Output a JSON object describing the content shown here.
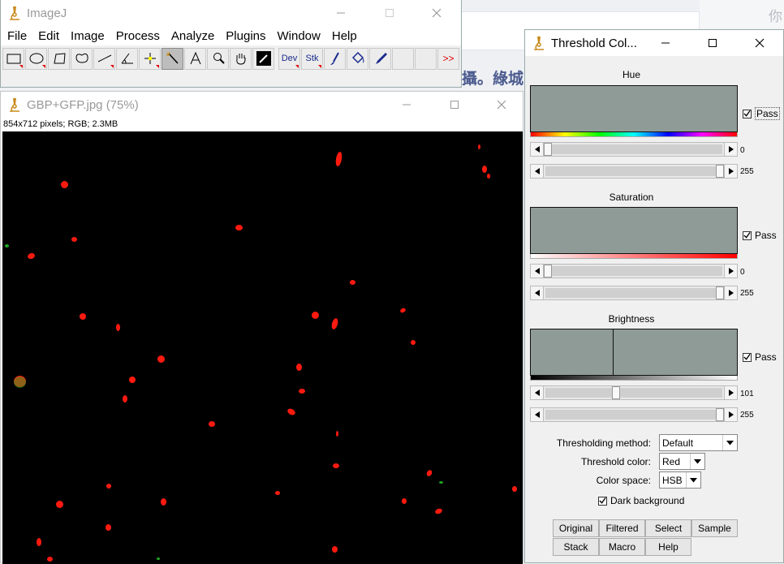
{
  "background": {
    "corner_glyph": "你",
    "heading_fragment": "攝。綠城"
  },
  "imagej": {
    "title": "ImageJ",
    "menu": [
      "File",
      "Edit",
      "Image",
      "Process",
      "Analyze",
      "Plugins",
      "Window",
      "Help"
    ],
    "tools": {
      "dev_label": "Dev",
      "stk_label": "Stk",
      "more_label": ">>"
    }
  },
  "image_window": {
    "title": "GBP+GFP.jpg (75%)",
    "info": "854x712 pixels; RGB; 2.3MB"
  },
  "threshold": {
    "title": "Threshold Col...",
    "hue": {
      "label": "Hue",
      "pass_label": "Pass",
      "pass_checked": true,
      "min": "0",
      "max": "255",
      "min_frac": 0.0,
      "max_frac": 1.0
    },
    "saturation": {
      "label": "Saturation",
      "pass_label": "Pass",
      "pass_checked": true,
      "min": "0",
      "max": "255",
      "min_frac": 0.0,
      "max_frac": 1.0
    },
    "brightness": {
      "label": "Brightness",
      "pass_label": "Pass",
      "pass_checked": true,
      "min": "101",
      "max": "255",
      "min_frac": 0.396,
      "max_frac": 1.0
    },
    "method_label": "Thresholding method:",
    "method_value": "Default",
    "color_label": "Threshold color:",
    "color_value": "Red",
    "space_label": "Color space:",
    "space_value": "HSB",
    "dark_bg_label": "Dark background",
    "dark_bg_checked": true,
    "buttons": [
      "Original",
      "Filtered",
      "Select",
      "Sample",
      "Stack",
      "Macro",
      "Help"
    ]
  },
  "colors": {
    "cell_red": "#ff1a10",
    "plot_gray": "#8e9b96",
    "title_gray": "#999999",
    "heading_blue": "#4b5a8e"
  }
}
